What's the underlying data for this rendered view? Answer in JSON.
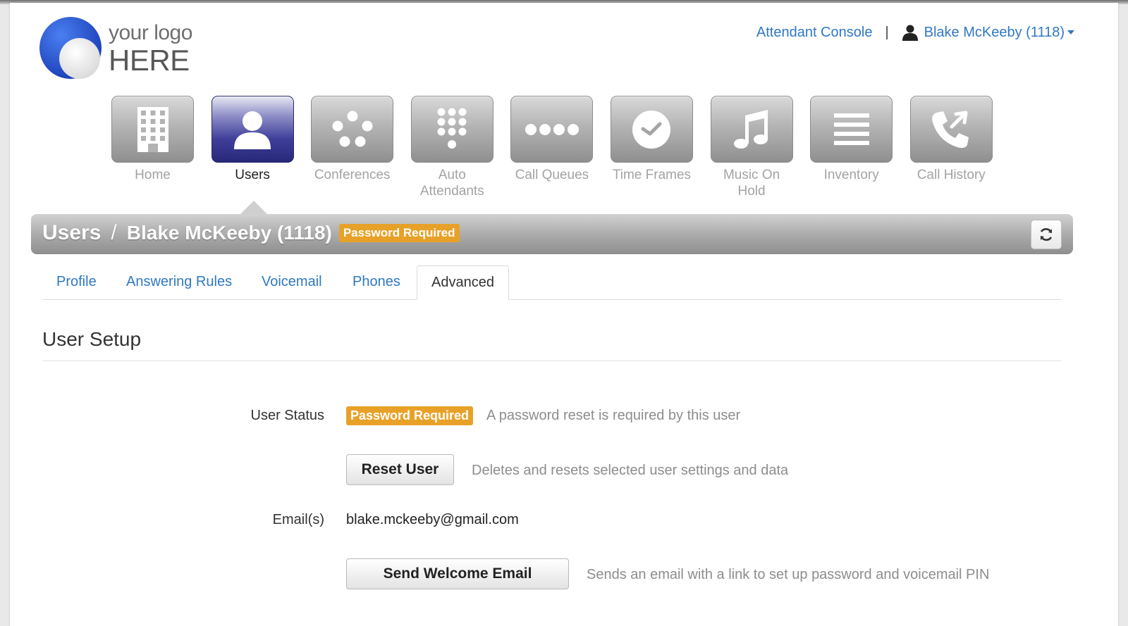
{
  "logo": {
    "line1": "your logo",
    "line2": "HERE"
  },
  "topbar": {
    "attendant_console": "Attendant Console",
    "separator": "|",
    "user_menu": "Blake McKeeby (1118)"
  },
  "nav": {
    "items": [
      {
        "label": "Home",
        "icon": "building-icon",
        "active": false
      },
      {
        "label": "Users",
        "icon": "user-icon",
        "active": true
      },
      {
        "label": "Conferences",
        "icon": "conference-icon",
        "active": false
      },
      {
        "label": "Auto Attendants",
        "icon": "keypad-icon",
        "active": false
      },
      {
        "label": "Call Queues",
        "icon": "queue-dots-icon",
        "active": false
      },
      {
        "label": "Time Frames",
        "icon": "clock-icon",
        "active": false
      },
      {
        "label": "Music On Hold",
        "icon": "music-note-icon",
        "active": false
      },
      {
        "label": "Inventory",
        "icon": "list-lines-icon",
        "active": false
      },
      {
        "label": "Call History",
        "icon": "phone-history-icon",
        "active": false
      }
    ]
  },
  "header": {
    "section": "Users",
    "separator": "/",
    "user": "Blake McKeeby (1118)",
    "badge": "Password Required"
  },
  "tabs": [
    {
      "label": "Profile",
      "active": false
    },
    {
      "label": "Answering Rules",
      "active": false
    },
    {
      "label": "Voicemail",
      "active": false
    },
    {
      "label": "Phones",
      "active": false
    },
    {
      "label": "Advanced",
      "active": true
    }
  ],
  "user_setup": {
    "title": "User Setup",
    "status_label": "User Status",
    "status_badge": "Password Required",
    "status_help": "A password reset is required by this user",
    "reset_button": "Reset User",
    "reset_help": "Deletes and resets selected user settings and data",
    "email_label": "Email(s)",
    "email_value": "blake.mckeeby@gmail.com",
    "welcome_button": "Send Welcome Email",
    "welcome_help": "Sends an email with a link to set up password and voicemail PIN"
  },
  "colors": {
    "link": "#2f78c4",
    "badge": "#e8a128",
    "active_tile": "#3f3f9a"
  }
}
